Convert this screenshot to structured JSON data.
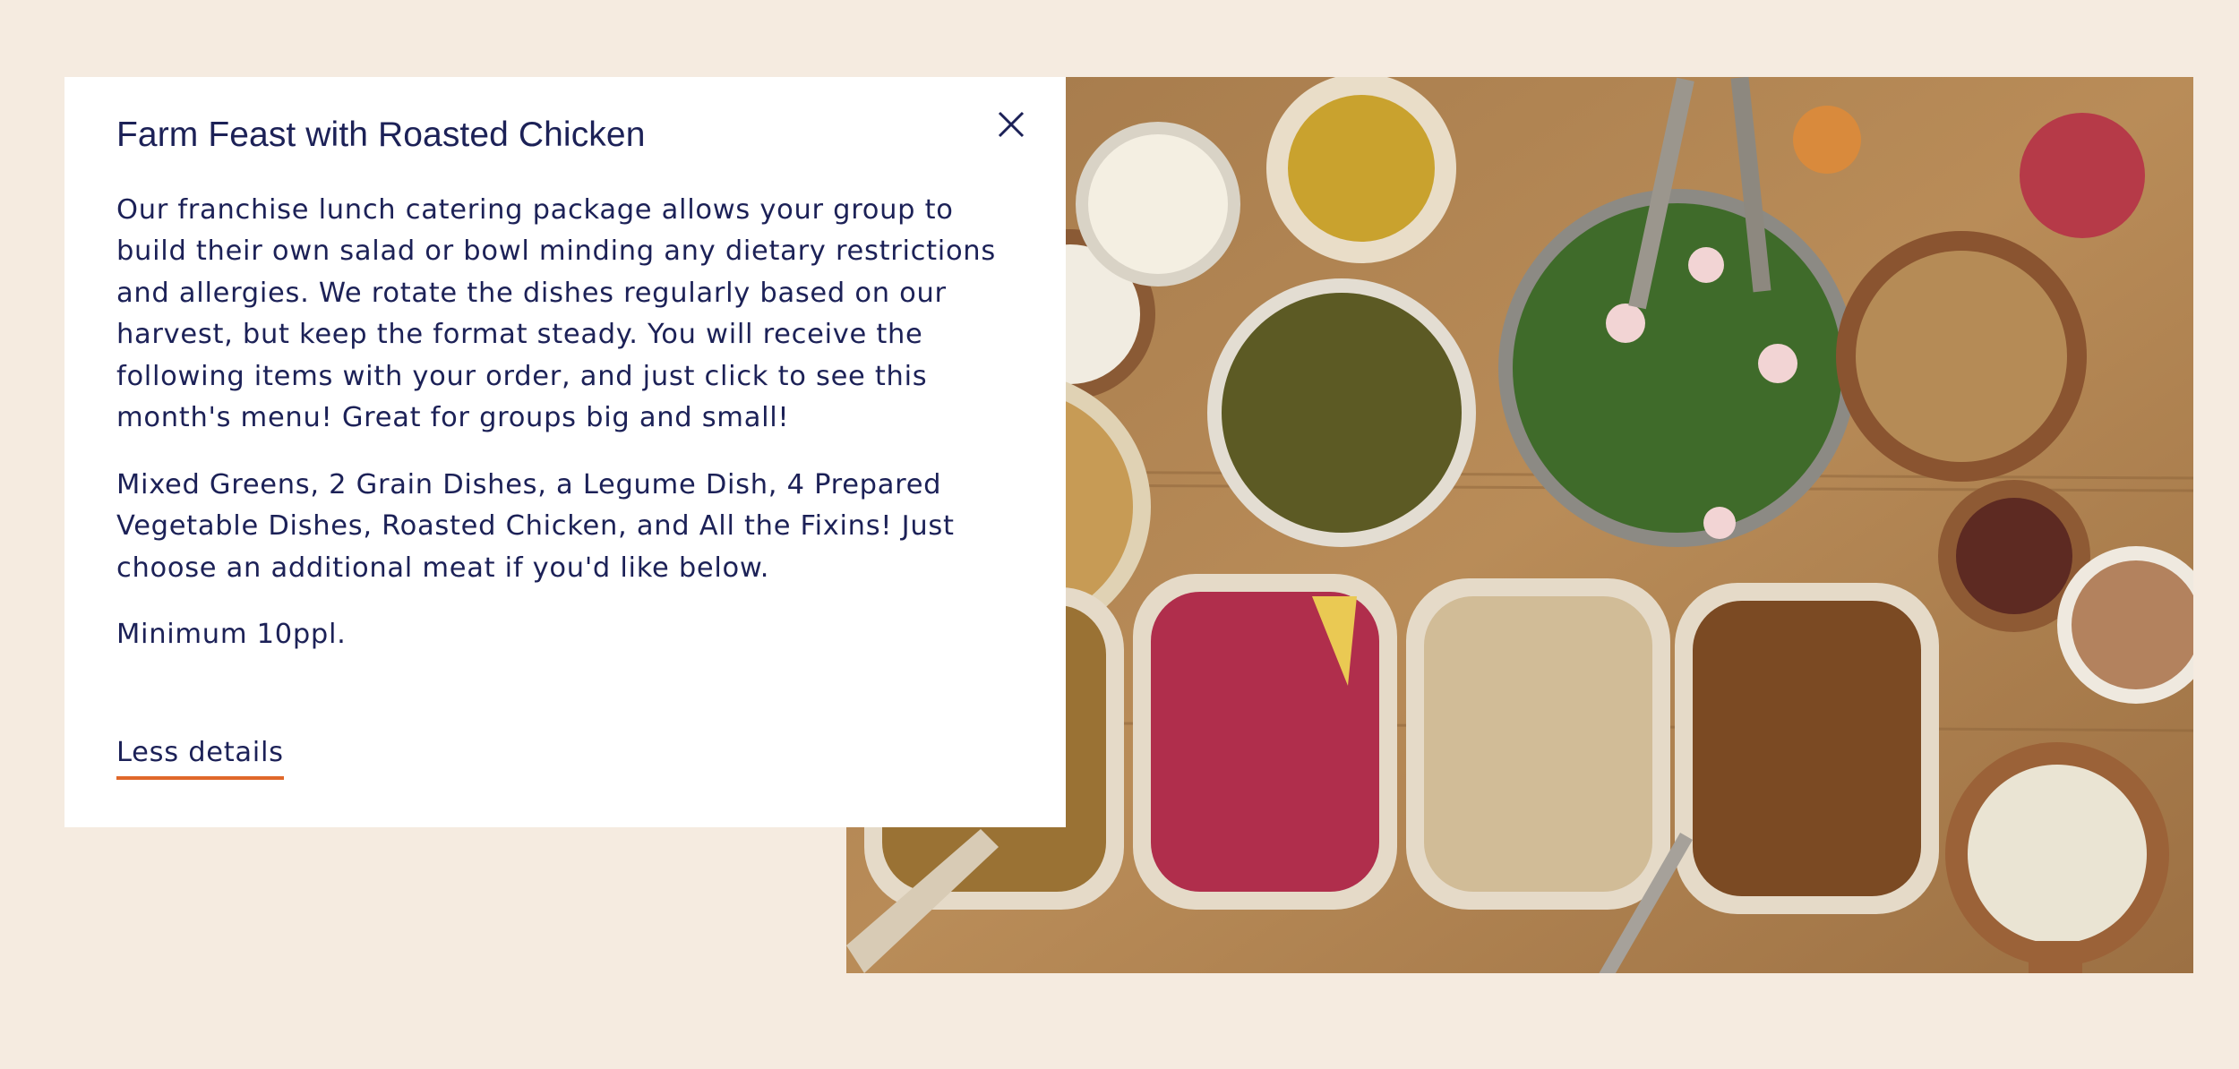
{
  "card": {
    "title": "Farm Feast with Roasted Chicken",
    "description": "Our franchise lunch catering package allows your group to build their own salad or bowl minding any dietary restrictions and allergies. We rotate the dishes regularly based on our harvest, but keep the format steady. You will receive the following items with your order, and just click to see this month's menu! Great for groups big and small!",
    "includes": "Mixed Greens, 2 Grain Dishes, a Legume Dish, 4 Prepared Vegetable Dishes, Roasted Chicken, and All the Fixins! Just choose an additional meat if you'd like below.",
    "minimum": "Minimum 10ppl.",
    "less_details_label": "Less details",
    "close_icon": "close-icon"
  },
  "colors": {
    "page_background": "#f5ebe0",
    "text": "#1c2157",
    "link_underline": "#e0682a",
    "card_background": "#ffffff"
  }
}
